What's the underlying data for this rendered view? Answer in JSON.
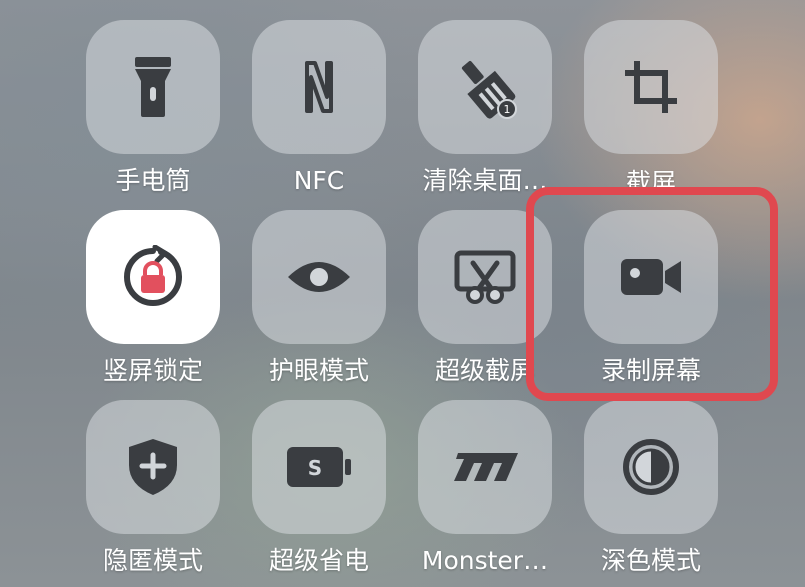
{
  "tiles": [
    {
      "id": "flashlight",
      "label": "手电筒",
      "icon": "flashlight-icon",
      "active": false
    },
    {
      "id": "nfc",
      "label": "NFC",
      "icon": "nfc-icon",
      "active": false
    },
    {
      "id": "clean-desktop",
      "label": "清除桌面…",
      "icon": "broom-icon",
      "badge": "1",
      "active": false
    },
    {
      "id": "screenshot",
      "label": "截屏",
      "icon": "crop-icon",
      "active": false
    },
    {
      "id": "rotation-lock",
      "label": "竖屏锁定",
      "icon": "rotation-lock-icon",
      "active": true
    },
    {
      "id": "eye-protect",
      "label": "护眼模式",
      "icon": "eye-icon",
      "active": false
    },
    {
      "id": "super-screenshot",
      "label": "超级截屏",
      "icon": "scissors-screen-icon",
      "active": false
    },
    {
      "id": "screen-record",
      "label": "录制屏幕",
      "icon": "video-camera-icon",
      "active": false
    },
    {
      "id": "privacy",
      "label": "隐匿模式",
      "icon": "shield-plus-icon",
      "active": false
    },
    {
      "id": "super-saver",
      "label": "超级省电",
      "icon": "battery-s-icon",
      "active": false
    },
    {
      "id": "monster",
      "label": "Monster…",
      "icon": "monster-logo-icon",
      "active": false
    },
    {
      "id": "dark-mode",
      "label": "深色模式",
      "icon": "dark-mode-icon",
      "active": false
    }
  ],
  "colors": {
    "icon": "#3a3d41",
    "active_tile": "#ffffff",
    "lock_accent": "#e2505e",
    "highlight": "#e0484f",
    "label": "#ffffff"
  }
}
